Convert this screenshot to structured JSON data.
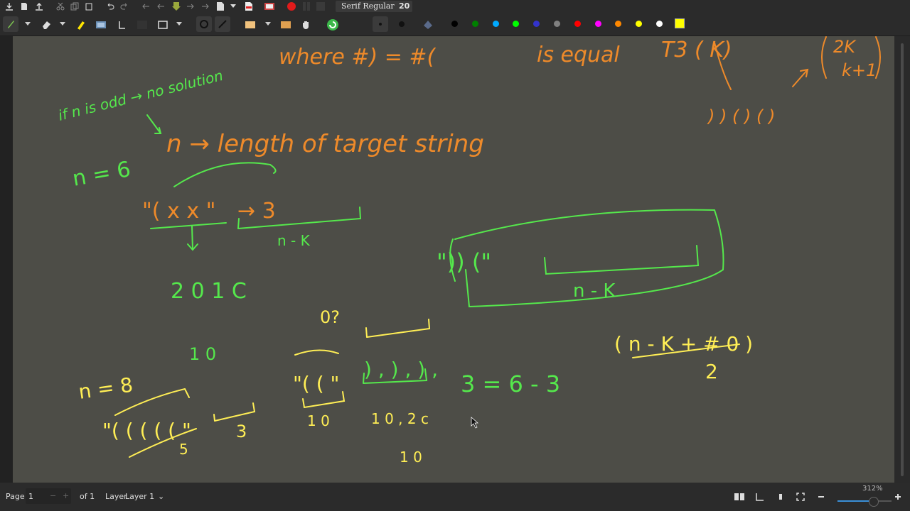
{
  "toolbar": {
    "font_name": "Serif Regular",
    "font_size": "20"
  },
  "palette": [
    "#000000",
    "#008000",
    "#00aaff",
    "#00ff00",
    "#3333cc",
    "#808080",
    "#ff0000",
    "#ff00ff",
    "#ff8800",
    "#ffff00",
    "#ffffff"
  ],
  "canvas": {
    "handwriting": {
      "l1": "where #) = #( is equal T3 ( K)",
      "l1a": "where #) = #(",
      "l1b": "is equal",
      "l1c": "T3 ( K)",
      "top_right_top": "2K",
      "top_right_bottom": "k+1",
      "right_parens": ") ) ( ) ( )",
      "odd_note": "if n is odd → no solution",
      "n_length": "n → length of target string",
      "n_eq_6": "n = 6",
      "example_a": "\"( x x \"",
      "arrow_3": "→ 3",
      "n_minus_k_small": "n - K",
      "counts_20_1c": "2 0    1 C",
      "q_zero": "0?",
      "one_zero": "1 0",
      "example_b": "\")) (\"",
      "n_minus_k_mid": "n - K",
      "eq_3_6_3": "3 = 6 - 3",
      "fraction_num": "( n - K + # 0 )",
      "fraction_den": "2",
      "n_eq_8": "n = 8",
      "example_c": "\"( ( ( ( ( \"",
      "five": "5",
      "three": "3",
      "example_d": "\"( ( \"",
      "ten_a": "1 0",
      "pairs": ") , ) , ) ,",
      "ten_2c": "1 0 , 2 c",
      "ten_b": "1 0"
    }
  },
  "status": {
    "page_label": "Page",
    "page_value": "1",
    "of_label": "of 1",
    "layer_label": "Layer",
    "layer_value": "Layer 1",
    "zoom": "312%"
  }
}
